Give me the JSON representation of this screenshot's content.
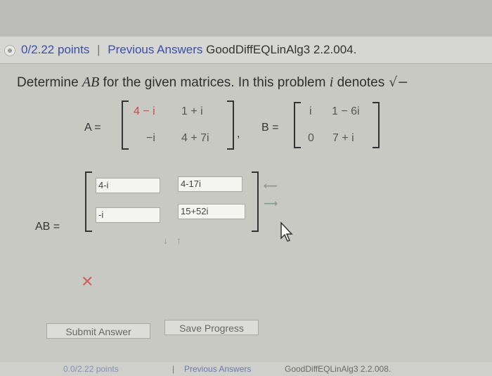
{
  "header": {
    "points": "0/2.22 points",
    "separator": "|",
    "previous_answers": "Previous Answers",
    "problem_id": "GoodDiffEQLinAlg3 2.2.004."
  },
  "problem": {
    "text_start": "Determine ",
    "var_ab": "AB",
    "text_mid": " for the given matrices. In this problem ",
    "var_i": "i",
    "text_end": " denotes",
    "sqrt_symbol": "√−"
  },
  "matrix_a": {
    "label": "A =",
    "cells": [
      "4 − i",
      "1 + i",
      "−i",
      "4 + 7i"
    ]
  },
  "matrix_b": {
    "label": "B =",
    "cells": [
      "i",
      "1 − 6i",
      "0",
      "7 + i"
    ]
  },
  "answer": {
    "label": "AB =",
    "cells": [
      "4-i",
      "4-17i",
      "-i",
      "15+52i"
    ]
  },
  "buttons": {
    "submit": "Submit Answer",
    "save": "Save Progress"
  },
  "footer": {
    "points": "0.0/2.22 points",
    "separator": "|",
    "previous_answers": "Previous Answers",
    "problem_id": "GoodDiffEQLinAlg3 2.2.008."
  }
}
